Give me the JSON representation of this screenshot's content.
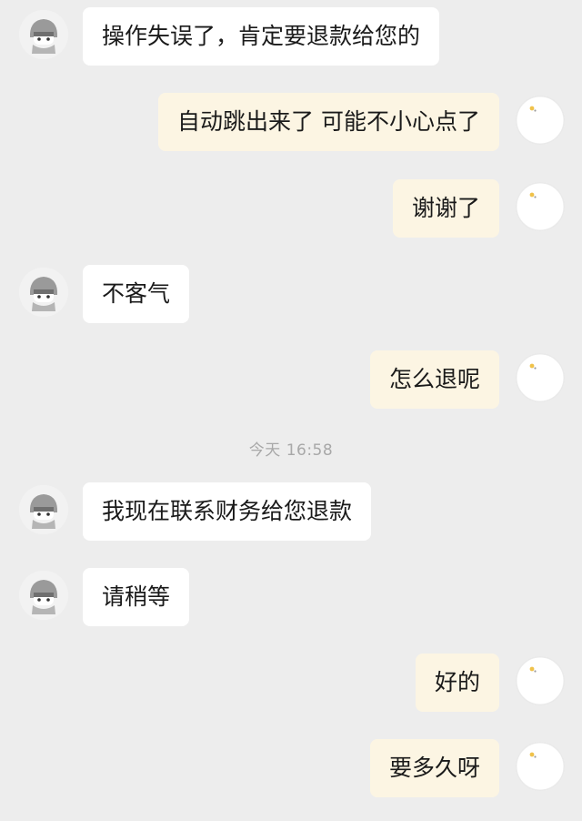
{
  "conversation": {
    "messages": [
      {
        "side": "left",
        "text": "操作失误了，肯定要退款给您的"
      },
      {
        "side": "right",
        "text": "自动跳出来了 可能不小心点了"
      },
      {
        "side": "right",
        "text": "谢谢了"
      },
      {
        "side": "left",
        "text": "不客气"
      },
      {
        "side": "right",
        "text": "怎么退呢"
      },
      {
        "side": "left",
        "text": "我现在联系财务给您退款"
      },
      {
        "side": "left",
        "text": "请稍等"
      },
      {
        "side": "right",
        "text": "好的"
      },
      {
        "side": "right",
        "text": "要多久呀"
      }
    ],
    "timestamp": "今天 16:58"
  },
  "avatars": {
    "agent_icon": "cartoon-agent-icon",
    "user_icon": "round-user-icon"
  }
}
